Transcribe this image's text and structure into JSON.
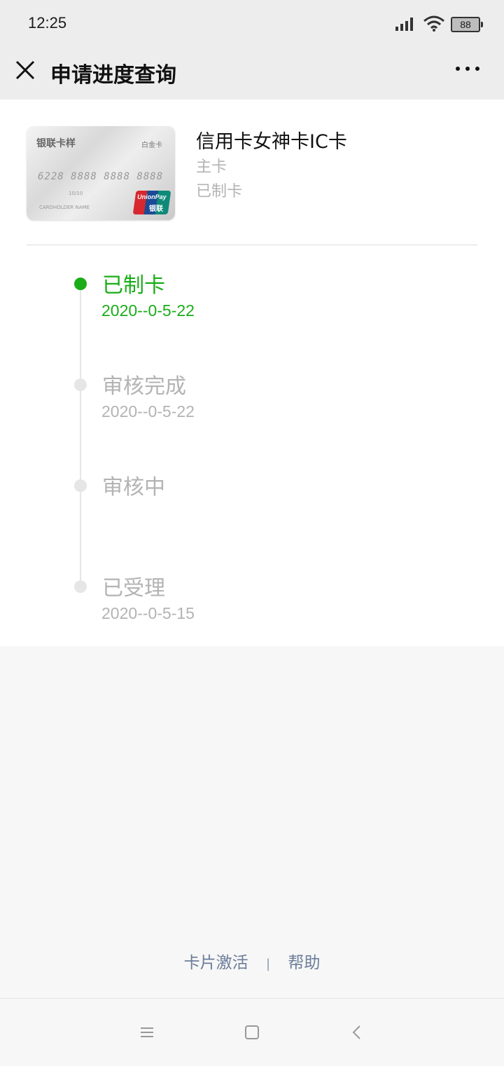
{
  "status_bar": {
    "time": "12:25",
    "battery": "88",
    "icons": [
      "signal-icon",
      "wifi-icon",
      "battery-icon"
    ]
  },
  "nav": {
    "title": "申请进度查询",
    "close_icon": "close-icon",
    "more_icon": "more-icon"
  },
  "card": {
    "image": {
      "bank_label": "银联卡样",
      "tier_label": "白金卡",
      "number": "6228 8888 8888 8888",
      "valid": "10/10",
      "holder": "CARDHOLDER NAME",
      "brand_en": "UnionPay",
      "brand_cn": "银联"
    },
    "name": "信用卡女神卡IC卡",
    "type": "主卡",
    "status": "已制卡"
  },
  "timeline": {
    "steps": [
      {
        "label": "已制卡",
        "date": "2020--0-5-22",
        "active": true
      },
      {
        "label": "审核完成",
        "date": "2020--0-5-22",
        "active": false
      },
      {
        "label": "审核中",
        "date": "",
        "active": false
      },
      {
        "label": "已受理",
        "date": "2020--0-5-15",
        "active": false
      }
    ],
    "active_color": "#1aad19",
    "inactive_color": "#b3b3b3"
  },
  "footer": {
    "activate_label": "卡片激活",
    "separator": "|",
    "help_label": "帮助"
  },
  "system_nav": {
    "buttons": [
      "menu-icon",
      "home-icon",
      "back-icon"
    ]
  }
}
